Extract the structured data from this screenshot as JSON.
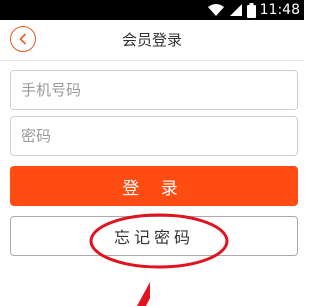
{
  "status_bar": {
    "time": "11:48",
    "icons": [
      "wifi-icon",
      "signal-icon",
      "battery-icon"
    ]
  },
  "nav": {
    "title": "会员登录",
    "back_icon": "chevron-left-icon"
  },
  "form": {
    "phone_placeholder": "手机号码",
    "password_placeholder": "密码",
    "login_label": "登 录",
    "forgot_label": "忘记密码"
  },
  "colors": {
    "accent": "#fe4c13",
    "back_icon": "#f15a22",
    "annotation": "#e0141e",
    "status_bar": "#000000"
  }
}
